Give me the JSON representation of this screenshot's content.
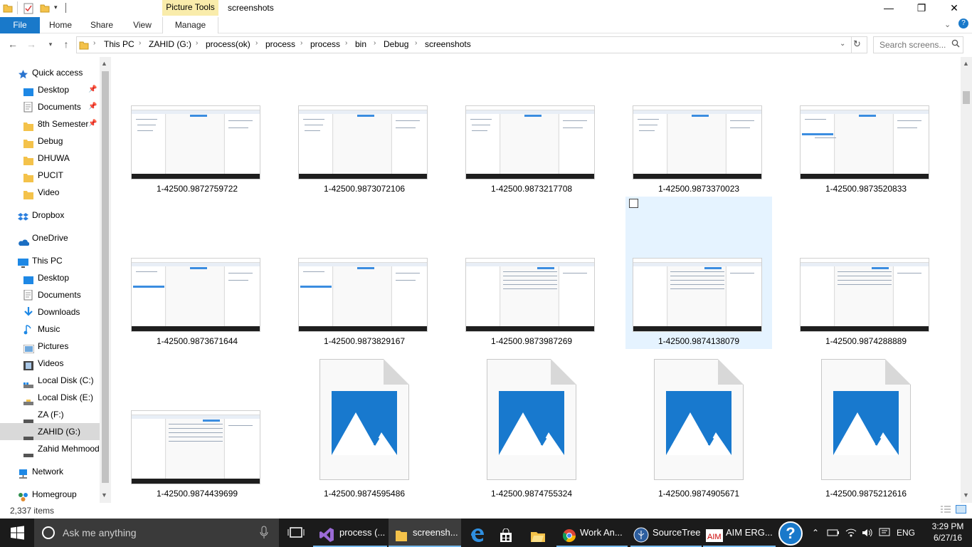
{
  "window": {
    "context_tab": "Picture Tools",
    "title": "screenshots",
    "minimize": "—",
    "maximize": "❐",
    "close": "✕"
  },
  "ribbon": {
    "file": "File",
    "tabs": [
      "Home",
      "Share",
      "View",
      "Manage"
    ],
    "expand_icon": "chevron-down-icon",
    "help": "?"
  },
  "address": {
    "crumbs": [
      "This PC",
      "ZAHID (G:)",
      "process(ok)",
      "process",
      "process",
      "bin",
      "Debug",
      "screenshots"
    ],
    "search_placeholder": "Search screens..."
  },
  "navpane": {
    "quick_access": "Quick access",
    "items": [
      {
        "label": "Desktop",
        "pinned": true
      },
      {
        "label": "Documents",
        "pinned": true
      },
      {
        "label": "8th Semester",
        "pinned": true
      },
      {
        "label": "Debug",
        "pinned": false
      },
      {
        "label": "DHUWA",
        "pinned": false
      },
      {
        "label": "PUCIT",
        "pinned": false
      },
      {
        "label": "Video",
        "pinned": false
      }
    ],
    "dropbox": "Dropbox",
    "onedrive": "OneDrive",
    "this_pc": "This PC",
    "pc_items": [
      "Desktop",
      "Documents",
      "Downloads",
      "Music",
      "Pictures",
      "Videos",
      "Local Disk (C:)",
      "Local Disk (E:)",
      "ZA (F:)",
      "ZAHID (G:)",
      "Zahid Mehmood"
    ],
    "network": "Network",
    "homegroup": "Homegroup"
  },
  "files": [
    {
      "name": "1-42500.9872759722",
      "type": "thumb"
    },
    {
      "name": "1-42500.9873072106",
      "type": "thumb"
    },
    {
      "name": "1-42500.9873217708",
      "type": "thumb"
    },
    {
      "name": "1-42500.9873370023",
      "type": "thumb"
    },
    {
      "name": "1-42500.9873520833",
      "type": "thumb"
    },
    {
      "name": "1-42500.9873671644",
      "type": "thumb"
    },
    {
      "name": "1-42500.9873829167",
      "type": "thumb"
    },
    {
      "name": "1-42500.9873987269",
      "type": "thumb"
    },
    {
      "name": "1-42500.9874138079",
      "type": "thumb",
      "selected": true
    },
    {
      "name": "1-42500.9874288889",
      "type": "thumb"
    },
    {
      "name": "1-42500.9874439699",
      "type": "thumb"
    },
    {
      "name": "1-42500.9874595486",
      "type": "icon"
    },
    {
      "name": "1-42500.9874755324",
      "type": "icon"
    },
    {
      "name": "1-42500.9874905671",
      "type": "icon"
    },
    {
      "name": "1-42500.9875212616",
      "type": "icon"
    }
  ],
  "status": {
    "item_count": "2,337 items"
  },
  "taskbar": {
    "search_text": "Ask me anything",
    "apps": [
      {
        "label": "process (...",
        "icon": "visual-studio-icon"
      },
      {
        "label": "screensh...",
        "icon": "folder-icon"
      },
      {
        "label": "",
        "icon": "edge-icon"
      },
      {
        "label": "",
        "icon": "store-icon"
      },
      {
        "label": "",
        "icon": "file-explorer-icon"
      },
      {
        "label": "Work An...",
        "icon": "chrome-icon"
      },
      {
        "label": "SourceTree",
        "icon": "sourcetree-icon"
      },
      {
        "label": "AIM ERG...",
        "icon": "aim-icon"
      }
    ],
    "language": "ENG",
    "time": "3:29 PM",
    "date": "6/27/16"
  },
  "colors": {
    "accent": "#1979ca",
    "selection": "#e5f3ff",
    "taskbar": "#1b1b1b"
  }
}
